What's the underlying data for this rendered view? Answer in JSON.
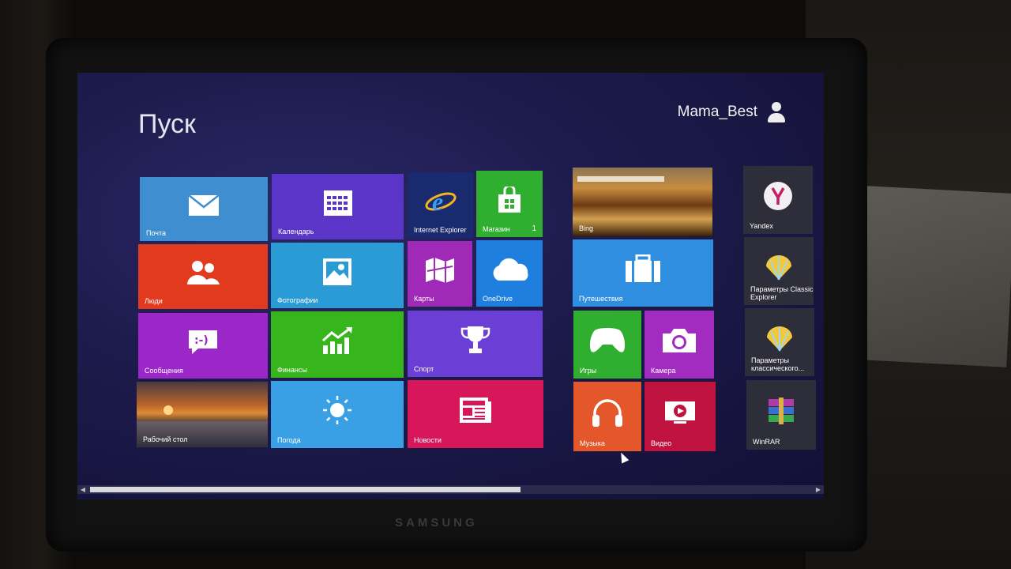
{
  "start": {
    "title": "Пуск",
    "user_name": "Mama_Best"
  },
  "tiles": {
    "mail": {
      "label": "Почта",
      "icon": "mail-icon",
      "color": "#3f8fd0"
    },
    "calendar": {
      "label": "Календарь",
      "icon": "calendar-icon",
      "color": "#5a35c8"
    },
    "ie": {
      "label": "Internet Explorer",
      "icon": "internet-explorer-icon",
      "color": "#1a2a6e"
    },
    "store": {
      "label": "Магазин",
      "badge": "1",
      "icon": "store-icon",
      "color": "#2fae2f"
    },
    "people": {
      "label": "Люди",
      "icon": "people-icon",
      "color": "#e23a1c"
    },
    "photos": {
      "label": "Фотографии",
      "icon": "photos-icon",
      "color": "#2b9bd6"
    },
    "maps": {
      "label": "Карты",
      "icon": "maps-icon",
      "color": "#a02ab8"
    },
    "onedrive": {
      "label": "OneDrive",
      "icon": "cloud-icon",
      "color": "#1e7fdf"
    },
    "messages": {
      "label": "Сообщения",
      "icon": "messaging-icon",
      "color": "#9b27c8"
    },
    "finance": {
      "label": "Финансы",
      "icon": "finance-chart-icon",
      "color": "#36b51c"
    },
    "sport": {
      "label": "Спорт",
      "icon": "trophy-icon",
      "color": "#6b3fd6"
    },
    "desktop": {
      "label": "Рабочий стол",
      "icon": "desktop-wallpaper",
      "color": "#b5682c"
    },
    "weather": {
      "label": "Погода",
      "icon": "sun-icon",
      "color": "#3aa0e6"
    },
    "news": {
      "label": "Новости",
      "icon": "news-icon",
      "color": "#d8175a"
    },
    "bing": {
      "label": "Bing",
      "icon": "bing-image",
      "color": "#8a5a1c"
    },
    "travel": {
      "label": "Путешествия",
      "icon": "suitcase-icon",
      "color": "#2f8ee0"
    },
    "games": {
      "label": "Игры",
      "icon": "xbox-controller-icon",
      "color": "#2fae2f"
    },
    "camera": {
      "label": "Камера",
      "icon": "camera-icon",
      "color": "#a22bc0"
    },
    "music": {
      "label": "Музыка",
      "icon": "headphones-icon",
      "color": "#e4572a"
    },
    "video": {
      "label": "Видео",
      "icon": "video-play-icon",
      "color": "#c0123e"
    },
    "yandex": {
      "label": "Yandex",
      "icon": "yandex-icon",
      "color": "#2e2d3a"
    },
    "classic_explorer": {
      "label": "Параметры Classic Explorer",
      "icon": "shell-icon",
      "color": "#2e2d3a"
    },
    "classic_shell": {
      "label": "Параметры классического...",
      "icon": "shell-icon",
      "color": "#2e2d3a"
    },
    "winrar": {
      "label": "WinRAR",
      "icon": "winrar-icon",
      "color": "#2e2d3a"
    }
  },
  "monitor": {
    "brand": "SAMSUNG"
  }
}
